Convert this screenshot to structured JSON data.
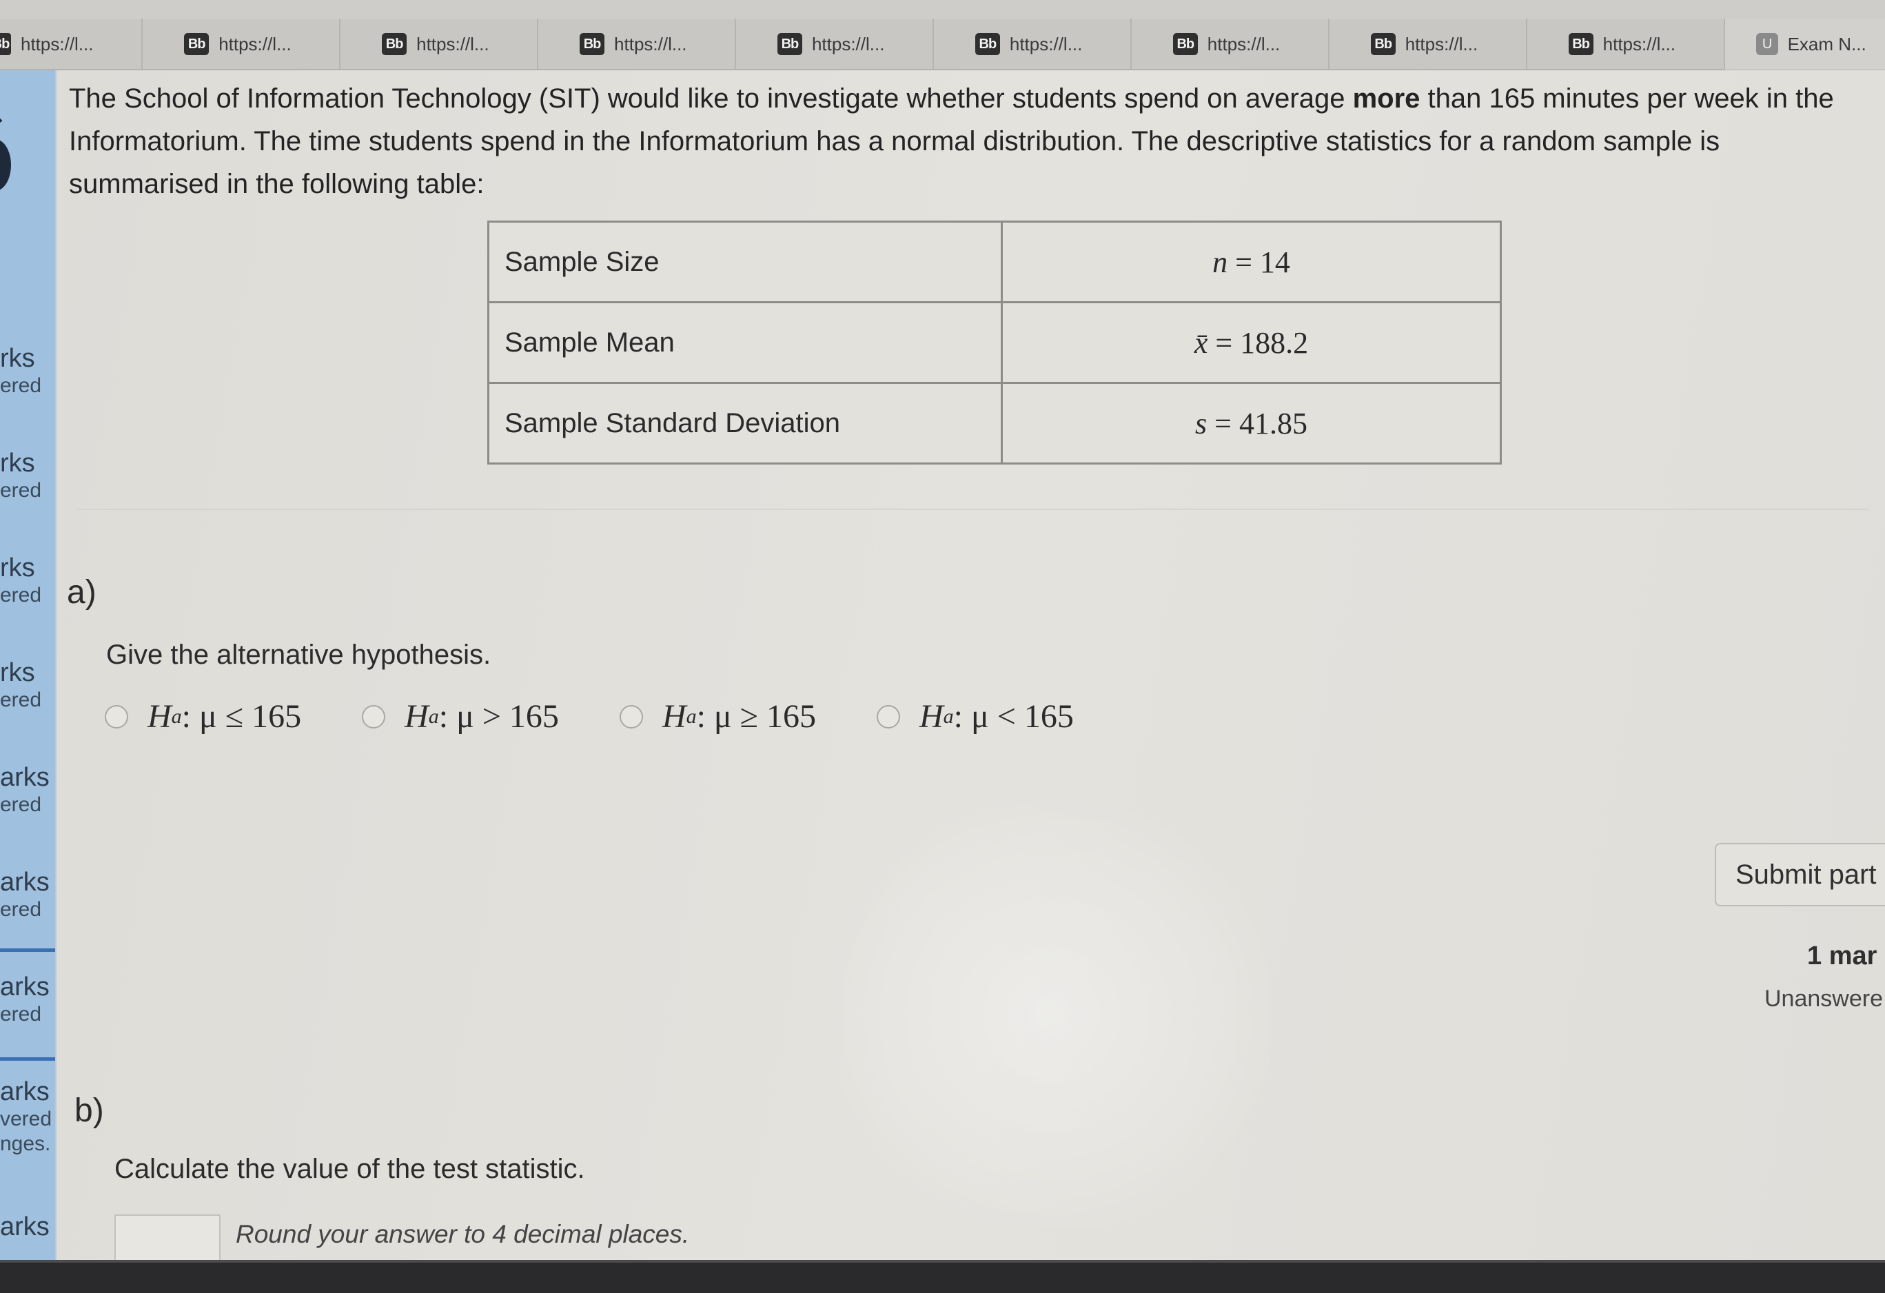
{
  "browser": {
    "tabs": [
      {
        "icon": "Bb",
        "label": "https://l..."
      },
      {
        "icon": "Bb",
        "label": "https://l..."
      },
      {
        "icon": "Bb",
        "label": "https://l..."
      },
      {
        "icon": "Bb",
        "label": "https://l..."
      },
      {
        "icon": "Bb",
        "label": "https://l..."
      },
      {
        "icon": "Bb",
        "label": "https://l..."
      },
      {
        "icon": "Bb",
        "label": "https://l..."
      },
      {
        "icon": "Bb",
        "label": "https://l..."
      },
      {
        "icon": "Bb",
        "label": "https://l..."
      },
      {
        "icon": "U",
        "label": "Exam N..."
      }
    ]
  },
  "sidebar": {
    "items": [
      {
        "marks": "rks",
        "status": "ered"
      },
      {
        "marks": "rks",
        "status": "ered"
      },
      {
        "marks": "rks",
        "status": "ered"
      },
      {
        "marks": "rks",
        "status": "ered"
      },
      {
        "marks": "arks",
        "status": "ered"
      },
      {
        "marks": "arks",
        "status": "ered"
      },
      {
        "marks": "arks",
        "status": "ered"
      },
      {
        "marks": "arks",
        "status": "vered",
        "extra": "nges."
      },
      {
        "marks": "arks",
        "status": ""
      }
    ]
  },
  "question": {
    "intro_part1": "The School of Information Technology (SIT) would like to investigate whether students spend on average ",
    "intro_bold": "more",
    "intro_part2": " than 165 minutes per week in the Informatorium. The time students spend in the Informatorium has a normal distribution. The descriptive statistics for a random sample is summarised in the following table:",
    "table": [
      {
        "label": "Sample Size",
        "symbol": "n",
        "value": " = 14"
      },
      {
        "label": "Sample Mean",
        "symbol": "x̄",
        "value": " = 188.2"
      },
      {
        "label": "Sample Standard Deviation",
        "symbol": "s",
        "value": " = 41.85"
      }
    ]
  },
  "part_a": {
    "label": "a)",
    "prompt": "Give the alternative hypothesis.",
    "options": [
      {
        "h": "H",
        "sub": "a",
        "rel": " : μ ≤ 165"
      },
      {
        "h": "H",
        "sub": "a",
        "rel": " : μ > 165"
      },
      {
        "h": "H",
        "sub": "a",
        "rel": " : μ ≥ 165"
      },
      {
        "h": "H",
        "sub": "a",
        "rel": " : μ < 165"
      }
    ],
    "submit_label": "Submit part",
    "marks": "1 mar",
    "status": "Unanswere"
  },
  "part_b": {
    "label": "b)",
    "prompt": "Calculate the value of the test statistic.",
    "answer_value": "",
    "hint": "Round your answer to 4 decimal places."
  }
}
